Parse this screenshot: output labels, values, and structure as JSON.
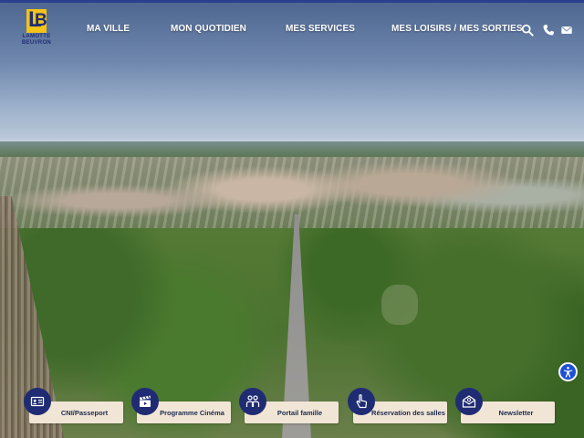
{
  "logo": {
    "line1": "LAMOTTE",
    "line2": "BEUVRON"
  },
  "nav": {
    "items": [
      {
        "label": "MA VILLE"
      },
      {
        "label": "MON QUOTIDIEN"
      },
      {
        "label": "MES SERVICES"
      },
      {
        "label": "MES LOISIRS / MES SORTIES"
      }
    ]
  },
  "header_icons": [
    "search-icon",
    "phone-icon",
    "mail-icon"
  ],
  "quick_links": [
    {
      "label": "CNI/Passeport",
      "icon": "id-card-icon"
    },
    {
      "label": "Programme Cinéma",
      "icon": "clapperboard-icon"
    },
    {
      "label": "Portail famille",
      "icon": "family-icon"
    },
    {
      "label": "Réservation des salles",
      "icon": "pointer-icon"
    },
    {
      "label": "Newsletter",
      "icon": "envelope-icon"
    }
  ],
  "accessibility_button": {
    "icon": "accessibility-icon"
  },
  "colors": {
    "brand_navy": "#1f2c73",
    "brand_yellow": "#f2c318",
    "card_bg": "#f1e6d6",
    "a11y_blue": "#1f4fd6"
  }
}
